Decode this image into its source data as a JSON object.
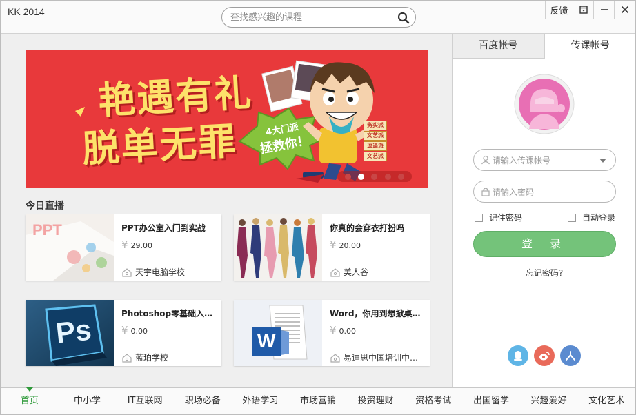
{
  "window": {
    "title": "KK 2014",
    "feedback_label": "反馈",
    "icons": [
      "dropdown-menu-icon",
      "minimize-icon",
      "close-icon"
    ]
  },
  "search": {
    "placeholder": "查找感兴趣的课程",
    "value": "",
    "icon": "search-icon"
  },
  "banner": {
    "line1": "艳遇有礼",
    "line2": "脱单无罪",
    "burst_line1": "4大门派",
    "burst_line2": "拯救你！",
    "tags": [
      "务实派",
      "文艺派",
      "逗逼派",
      "文艺派"
    ],
    "slide_count": 5,
    "active_slide": 2,
    "colors": {
      "background": "#e8393b",
      "headline": "#fde26a"
    }
  },
  "live": {
    "section_title": "今日直播",
    "currency": "¥",
    "courses": [
      {
        "title": "PPT办公室入门到实战",
        "price": "29.00",
        "school": "天宇电脑学校",
        "thumb_text": "PPT"
      },
      {
        "title": "你真的会穿衣打扮吗",
        "price": "20.00",
        "school": "美人谷"
      },
      {
        "title": "Photoshop零基础入门…",
        "price": "0.00",
        "school": "蓝珀学校",
        "thumb_text": "Ps"
      },
      {
        "title": "Word，你用到想掀桌…",
        "price": "0.00",
        "school": "易迪思中国培训中…",
        "thumb_text": "W"
      }
    ]
  },
  "login": {
    "tabs": [
      {
        "label": "百度帐号",
        "active": false
      },
      {
        "label": "传课帐号",
        "active": true
      }
    ],
    "account_placeholder": "请输入传课帐号",
    "account_value": "",
    "password_placeholder": "请输入密码",
    "password_value": "",
    "remember_label": "记住密码",
    "auto_login_label": "自动登录",
    "remember_checked": false,
    "auto_login_checked": false,
    "login_label": "登 录",
    "forgot_label": "忘记密码?",
    "social": [
      {
        "name": "qq-icon",
        "color": "#5fb5e6"
      },
      {
        "name": "weibo-icon",
        "color": "#e96a5a"
      },
      {
        "name": "renren-icon",
        "color": "#5b8bd0"
      }
    ],
    "colors": {
      "login_button": "#74c37a",
      "avatar": "#e86fb4"
    }
  },
  "nav": {
    "items": [
      "首页",
      "中小学",
      "IT互联网",
      "职场必备",
      "外语学习",
      "市场营销",
      "投资理财",
      "资格考试",
      "出国留学",
      "兴趣爱好",
      "文化艺术"
    ],
    "active_index": 0,
    "active_color": "#2f9a3a"
  }
}
